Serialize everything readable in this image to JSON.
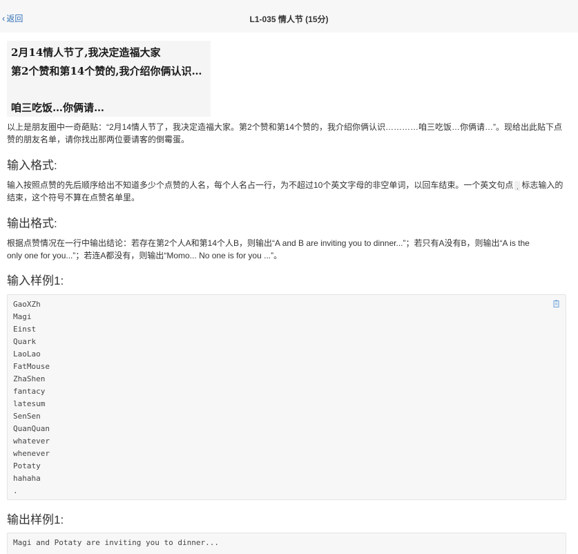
{
  "header": {
    "back_label": "返回",
    "title": "L1-035 情人节 (15分)"
  },
  "meme": {
    "lines": [
      "2月14情人节了,我决定造福大家",
      "第2个赞和第14个赞的,我介绍你俩认识…",
      "咱三吃饭…你俩请…"
    ]
  },
  "description": {
    "line1": "以上是朋友圈中一奇葩贴：“2月14情人节了，我决定造福大家。第2个赞和第14个赞的，我介绍你俩认识…………咱三吃饭…你俩请…”。现给出此贴下点",
    "line2": "赞的朋友名单，请你找出那两位要请客的倒霉蛋。"
  },
  "input_format": {
    "heading": "输入格式:",
    "line1_before": "输入按照点赞的先后顺序给出不知道多少个点赞的人名，每个人名占一行，为不超过10个英文字母的非空单词，以回车结束。一个英文句点",
    "code": ".",
    "line1_after": "标志输入的",
    "line2": "结束，这个符号不算在点赞名单里。"
  },
  "output_format": {
    "heading": "输出格式:",
    "line1": "根据点赞情况在一行中输出结论：若存在第2个人A和第14个人B，则输出“A and B are inviting you to dinner...”；若只有A没有B，则输出“A is the",
    "line2": "only one for you...”；若连A都没有，则输出“Momo... No one is for you ...”。"
  },
  "sample_input": {
    "heading": "输入样例1:",
    "lines": [
      "GaoXZh",
      "Magi",
      "Einst",
      "Quark",
      "LaoLao",
      "FatMouse",
      "ZhaShen",
      "fantacy",
      "latesum",
      "SenSen",
      "QuanQuan",
      "whatever",
      "whenever",
      "Potaty",
      "hahaha",
      "."
    ]
  },
  "sample_output": {
    "heading": "输出样例1:",
    "lines": [
      "Magi and Potaty are inviting you to dinner..."
    ]
  },
  "icons": {
    "back": "chevron-left-icon",
    "copy": "clipboard-copy-icon"
  },
  "colors": {
    "link": "#2f6fb3",
    "code_bg": "#f7f7f8"
  }
}
